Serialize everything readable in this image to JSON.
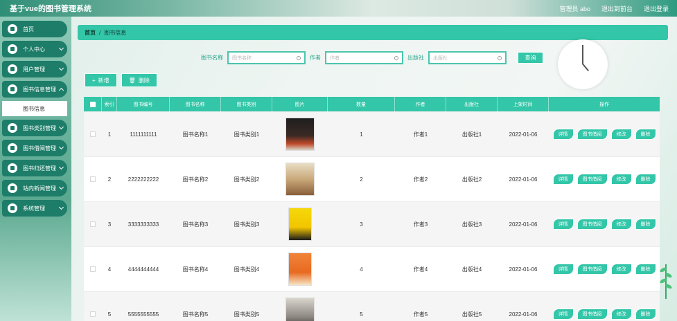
{
  "header": {
    "app_title": "基于vue的图书管理系统",
    "admin_text": "管理员 abo",
    "exit_backend": "退出到前台",
    "logout": "退出登录"
  },
  "sidebar": {
    "items": [
      {
        "label": "首页",
        "icon": "home-icon",
        "expandable": false
      },
      {
        "label": "个人中心",
        "icon": "user-icon",
        "expandable": true
      },
      {
        "label": "用户管理",
        "icon": "users-icon",
        "expandable": true
      },
      {
        "label": "图书信息管理",
        "icon": "book-icon",
        "expandable": true
      }
    ],
    "subitem": "图书信息",
    "items_after": [
      {
        "label": "图书类别管理",
        "icon": "category-icon"
      },
      {
        "label": "图书借阅管理",
        "icon": "borrow-icon"
      },
      {
        "label": "图书归还管理",
        "icon": "return-icon"
      },
      {
        "label": "站内新闻管理",
        "icon": "news-icon"
      },
      {
        "label": "系统管理",
        "icon": "settings-icon"
      }
    ]
  },
  "breadcrumb": {
    "home": "首页",
    "separator": "/",
    "current": "图书信息"
  },
  "search": {
    "name_label": "图书名称",
    "name_placeholder": "图书名称",
    "author_label": "作者",
    "author_placeholder": "作者",
    "publisher_label": "出版社",
    "publisher_placeholder": "出版社",
    "query_button": "查询"
  },
  "actions": {
    "add": "新增",
    "delete": "删除"
  },
  "table": {
    "headers": [
      "索引",
      "图书编号",
      "图书名称",
      "图书类别",
      "图片",
      "数量",
      "作者",
      "出版社",
      "上架时间",
      "操作"
    ],
    "rows": [
      {
        "idx": "1",
        "no": "1111111111",
        "name": "图书名称1",
        "category": "图书类别1",
        "qty": "1",
        "author": "作者1",
        "publisher": "出版社1",
        "date": "2022-01-06"
      },
      {
        "idx": "2",
        "no": "2222222222",
        "name": "图书名称2",
        "category": "图书类别2",
        "qty": "2",
        "author": "作者2",
        "publisher": "出版社2",
        "date": "2022-01-06"
      },
      {
        "idx": "3",
        "no": "3333333333",
        "name": "图书名称3",
        "category": "图书类别3",
        "qty": "3",
        "author": "作者3",
        "publisher": "出版社3",
        "date": "2022-01-06"
      },
      {
        "idx": "4",
        "no": "4444444444",
        "name": "图书名称4",
        "category": "图书类别4",
        "qty": "4",
        "author": "作者4",
        "publisher": "出版社4",
        "date": "2022-01-06"
      },
      {
        "idx": "5",
        "no": "5555555555",
        "name": "图书名称5",
        "category": "图书类别5",
        "qty": "5",
        "author": "作者5",
        "publisher": "出版社5",
        "date": "2022-01-06"
      }
    ],
    "ops": {
      "detail": "详情",
      "borrow": "图书借阅",
      "edit": "修改",
      "delete": "删除"
    }
  },
  "colors": {
    "accent": "#33c6a8",
    "sidebar_item": "#1d7d68"
  }
}
